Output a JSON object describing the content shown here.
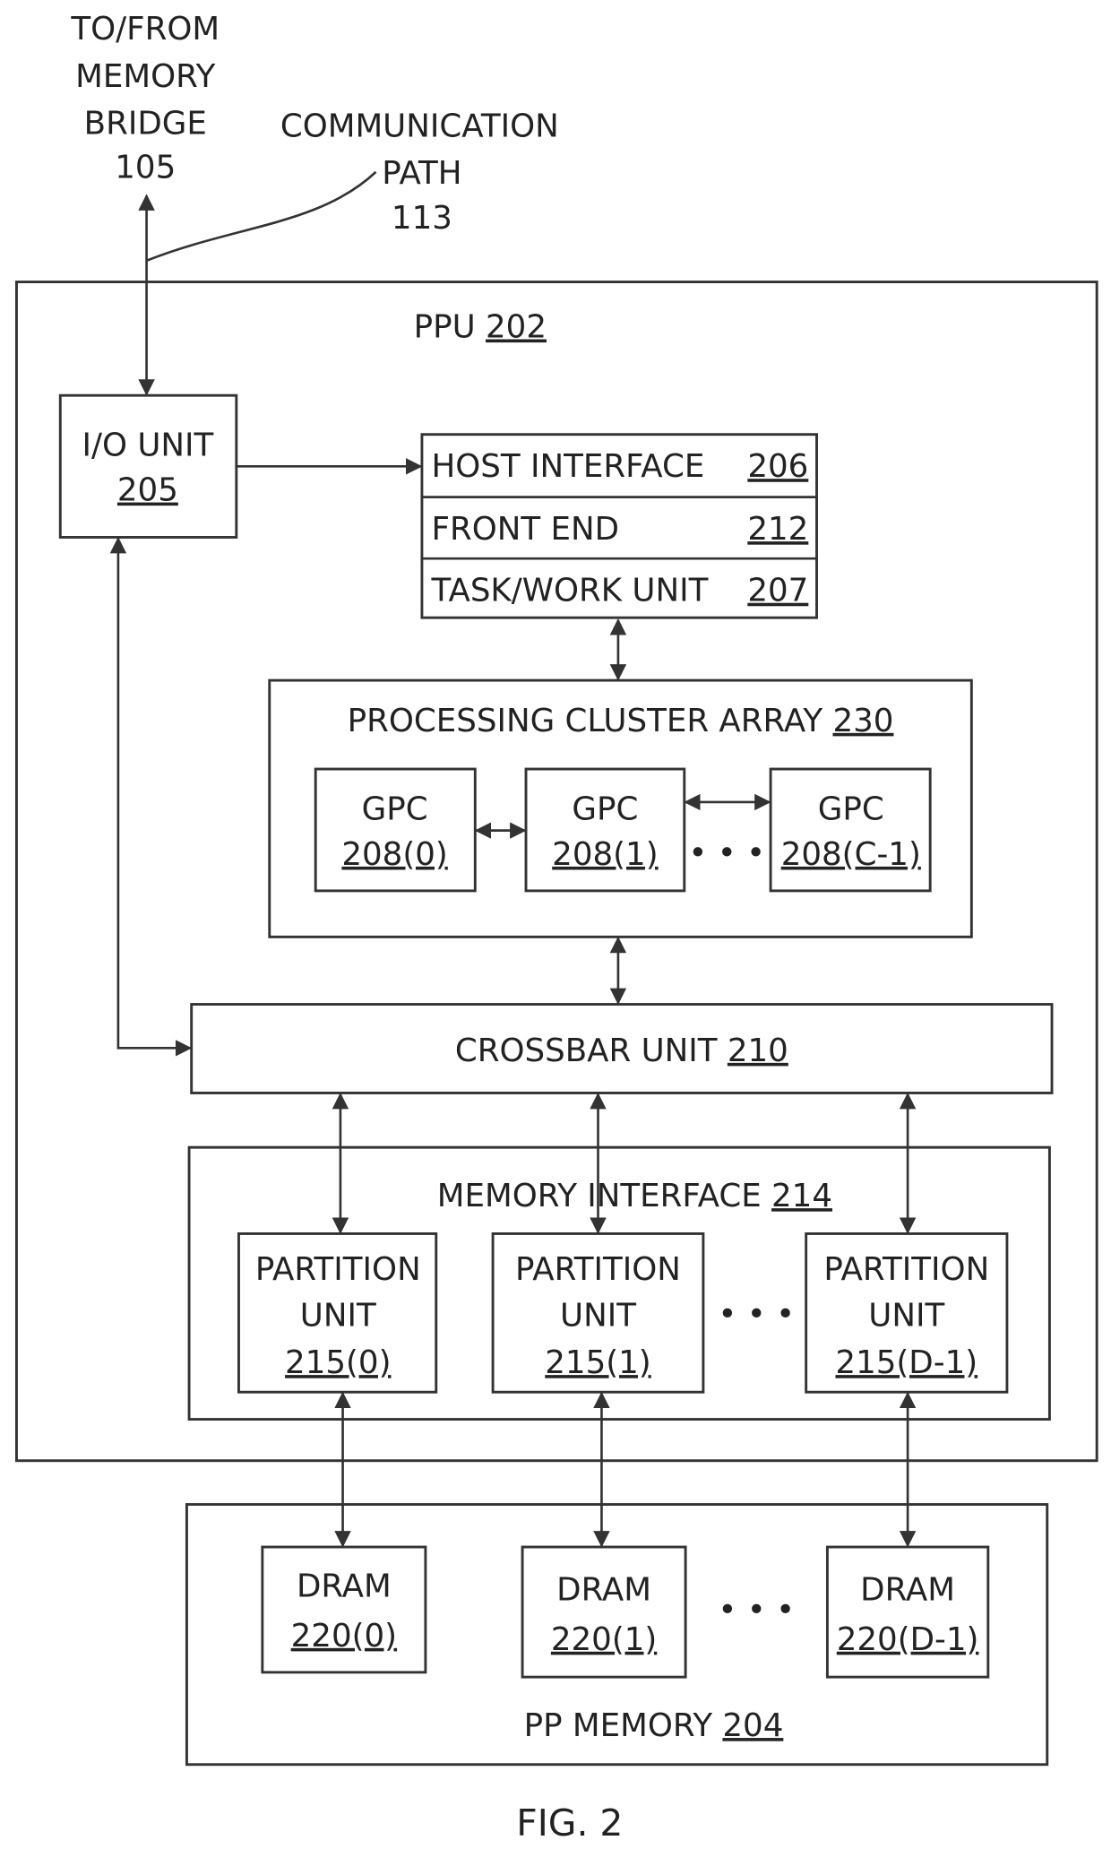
{
  "labels": {
    "to_from_1": "TO/FROM",
    "to_from_2": "MEMORY",
    "to_from_3": "BRIDGE",
    "to_from_ref": "105",
    "comm_1": "COMMUNICATION",
    "comm_2": "PATH",
    "comm_ref": "113",
    "ppu": "PPU ",
    "ppu_ref": "202",
    "io": "I/O UNIT",
    "io_ref": "205",
    "host": "HOST INTERFACE",
    "host_ref": "206",
    "front": "FRONT END",
    "front_ref": "212",
    "task": "TASK/WORK UNIT ",
    "task_ref": "207",
    "pca": "PROCESSING CLUSTER ARRAY ",
    "pca_ref": "230",
    "gpc": "GPC",
    "gpc0": "208(0)",
    "gpc1": "208(1)",
    "gpcN": "208(C-1)",
    "crossbar": "CROSSBAR UNIT ",
    "crossbar_ref": "210",
    "memif": "MEMORY INTERFACE ",
    "memif_ref": "214",
    "partition": "PARTITION",
    "unit": "UNIT",
    "p0": "215(0)",
    "p1": "215(1)",
    "pN": "215(D-1)",
    "dram": "DRAM",
    "d0": "220(0)",
    "d1": "220(1)",
    "dN": "220(D-1)",
    "ppmem": "PP MEMORY ",
    "ppmem_ref": "204",
    "ellipsis": "• • •",
    "fig": "FIG. 2"
  }
}
